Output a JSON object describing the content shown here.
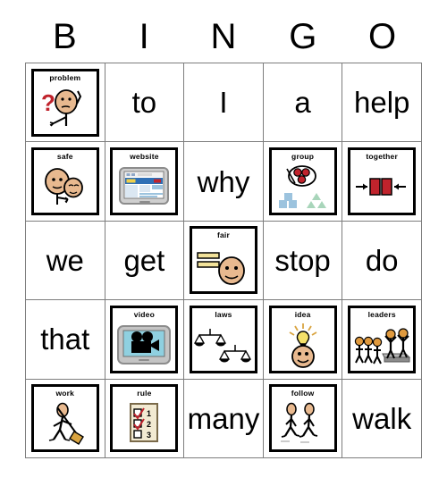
{
  "card": {
    "title": "BINGO card",
    "header_letters": [
      "B",
      "I",
      "N",
      "G",
      "O"
    ],
    "rows": 5,
    "columns": 5,
    "colors": {
      "grid_line": "#7d7d7d",
      "tile_border": "#000000",
      "skin": "#e8b98f",
      "red": "#c0232c",
      "blue": "#9cc3de",
      "green": "#a8d5ba",
      "yellow": "#f2e29a",
      "gray": "#b3b3b3",
      "lightblue": "#8fd0e0"
    }
  },
  "cells": [
    {
      "column": "B",
      "row": 1,
      "type": "picture",
      "label": "problem",
      "icon": "problem-icon",
      "text": ""
    },
    {
      "column": "I",
      "row": 1,
      "type": "word",
      "label": "",
      "icon": "",
      "text": "to"
    },
    {
      "column": "N",
      "row": 1,
      "type": "word",
      "label": "",
      "icon": "",
      "text": "I"
    },
    {
      "column": "G",
      "row": 1,
      "type": "word",
      "label": "",
      "icon": "",
      "text": "a"
    },
    {
      "column": "O",
      "row": 1,
      "type": "word",
      "label": "",
      "icon": "",
      "text": "help"
    },
    {
      "column": "B",
      "row": 2,
      "type": "picture",
      "label": "safe",
      "icon": "safe-icon",
      "text": ""
    },
    {
      "column": "I",
      "row": 2,
      "type": "picture",
      "label": "website",
      "icon": "website-icon",
      "text": ""
    },
    {
      "column": "N",
      "row": 2,
      "type": "word",
      "label": "",
      "icon": "",
      "text": "why"
    },
    {
      "column": "G",
      "row": 2,
      "type": "picture",
      "label": "group",
      "icon": "group-icon",
      "text": ""
    },
    {
      "column": "O",
      "row": 2,
      "type": "picture",
      "label": "together",
      "icon": "together-icon",
      "text": ""
    },
    {
      "column": "B",
      "row": 3,
      "type": "word",
      "label": "",
      "icon": "",
      "text": "we"
    },
    {
      "column": "I",
      "row": 3,
      "type": "word",
      "label": "",
      "icon": "",
      "text": "get"
    },
    {
      "column": "N",
      "row": 3,
      "type": "picture",
      "label": "fair",
      "icon": "fair-icon",
      "text": ""
    },
    {
      "column": "G",
      "row": 3,
      "type": "word",
      "label": "",
      "icon": "",
      "text": "stop"
    },
    {
      "column": "O",
      "row": 3,
      "type": "word",
      "label": "",
      "icon": "",
      "text": "do"
    },
    {
      "column": "B",
      "row": 4,
      "type": "word",
      "label": "",
      "icon": "",
      "text": "that"
    },
    {
      "column": "I",
      "row": 4,
      "type": "picture",
      "label": "video",
      "icon": "video-icon",
      "text": ""
    },
    {
      "column": "N",
      "row": 4,
      "type": "picture",
      "label": "laws",
      "icon": "laws-icon",
      "text": ""
    },
    {
      "column": "G",
      "row": 4,
      "type": "picture",
      "label": "idea",
      "icon": "idea-icon",
      "text": ""
    },
    {
      "column": "O",
      "row": 4,
      "type": "picture",
      "label": "leaders",
      "icon": "leaders-icon",
      "text": ""
    },
    {
      "column": "B",
      "row": 5,
      "type": "picture",
      "label": "work",
      "icon": "work-icon",
      "text": ""
    },
    {
      "column": "I",
      "row": 5,
      "type": "picture",
      "label": "rule",
      "icon": "rule-icon",
      "text": ""
    },
    {
      "column": "N",
      "row": 5,
      "type": "word",
      "label": "",
      "icon": "",
      "text": "many"
    },
    {
      "column": "G",
      "row": 5,
      "type": "picture",
      "label": "follow",
      "icon": "follow-icon",
      "text": ""
    },
    {
      "column": "O",
      "row": 5,
      "type": "word",
      "label": "",
      "icon": "",
      "text": "walk"
    }
  ],
  "rule_tile": {
    "items": [
      "1",
      "2",
      "3"
    ],
    "checked": [
      true,
      true,
      false
    ]
  }
}
